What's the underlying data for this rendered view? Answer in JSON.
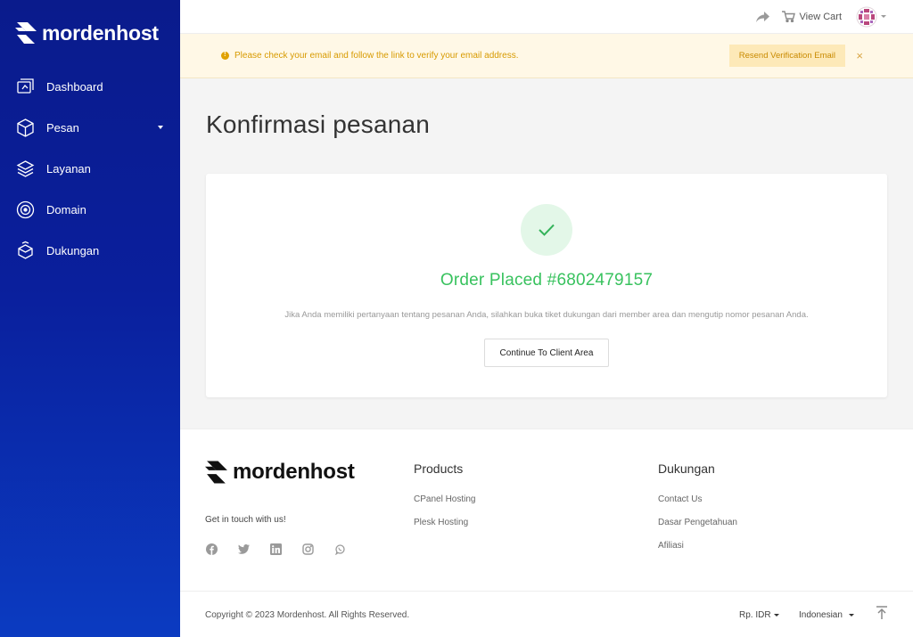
{
  "brand": {
    "name": "mordenhost"
  },
  "sidebar": {
    "items": [
      {
        "label": "Dashboard",
        "icon": "dashboard-icon"
      },
      {
        "label": "Pesan",
        "icon": "box-icon"
      },
      {
        "label": "Layanan",
        "icon": "layers-icon"
      },
      {
        "label": "Domain",
        "icon": "globe-icon"
      },
      {
        "label": "Dukungan",
        "icon": "support-box-icon"
      }
    ]
  },
  "topbar": {
    "view_cart_label": "View Cart"
  },
  "alert": {
    "message": "Please check your email and follow the link to verify your email address.",
    "button_label": "Resend Verification Email",
    "close_glyph": "×"
  },
  "main": {
    "title": "Konfirmasi pesanan",
    "order_placed": "Order Placed #6802479157",
    "description": "Jika Anda memiliki pertanyaan tentang pesanan Anda, silahkan buka tiket dukungan dari member area dan mengutip nomor pesanan Anda.",
    "continue_label": "Continue To Client Area"
  },
  "footer": {
    "tagline": "Get in touch with us!",
    "socials": [
      "facebook-icon",
      "twitter-icon",
      "linkedin-icon",
      "instagram-icon",
      "whatsapp-icon"
    ],
    "products": {
      "title": "Products",
      "links": [
        "CPanel Hosting",
        "Plesk Hosting"
      ]
    },
    "support": {
      "title": "Dukungan",
      "links": [
        "Contact Us",
        "Dasar Pengetahuan",
        "Afiliasi"
      ]
    },
    "copyright": "Copyright © 2023 Mordenhost. All Rights Reserved.",
    "currency": "Rp. IDR",
    "language": "Indonesian"
  },
  "colors": {
    "sidebar_top": "#0a1b8c",
    "sidebar_bottom": "#0b3bc1",
    "success": "#38c25e",
    "alert_bg": "#fff8e6",
    "alert_text": "#d79a00"
  }
}
